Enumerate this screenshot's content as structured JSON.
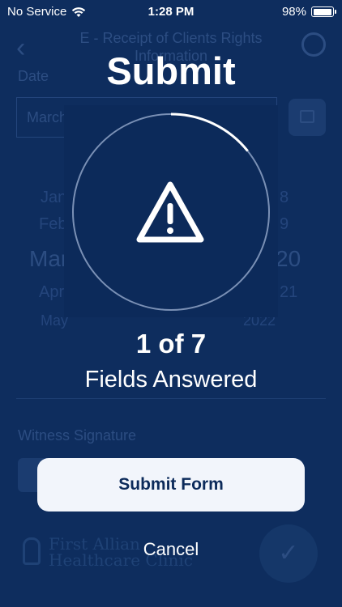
{
  "status_bar": {
    "carrier": "No Service",
    "time": "1:28 PM",
    "battery": "98%",
    "battery_level": 0.98
  },
  "background_form": {
    "title": "E - Receipt of Clients Rights Information",
    "date_label": "Date",
    "date_value": "March",
    "picker": {
      "months": [
        "Jan",
        "Feb",
        "Mar",
        "Apr",
        "May"
      ],
      "years": [
        "8",
        "9",
        "20",
        "21",
        "2022"
      ]
    },
    "witness_label": "Witness Signature",
    "logo_line1": "First Allian",
    "logo_line2": "Healthcare Clinic"
  },
  "dialog": {
    "title": "Submit",
    "answered_count": 1,
    "total_count": 7,
    "progress_text": "1 of 7",
    "subtitle": "Fields Answered",
    "submit_label": "Submit Form",
    "cancel_label": "Cancel",
    "colors": {
      "background": "#0e2d5e",
      "panel": "#0c2a5a",
      "button": "#f2f5fb",
      "ring_track": "#7a90b5",
      "ring_progress": "#ffffff"
    }
  }
}
